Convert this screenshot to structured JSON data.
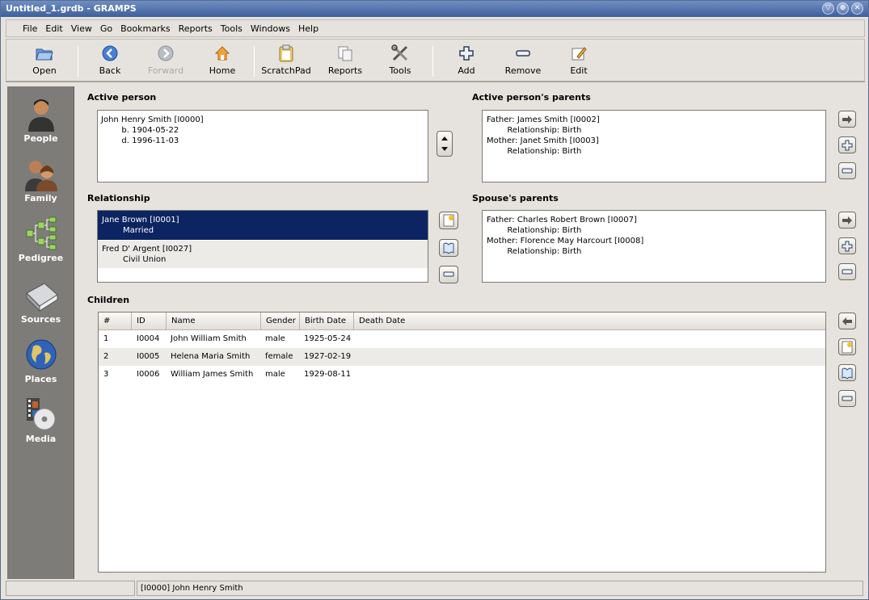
{
  "window": {
    "title": "Untitled_1.grdb - GRAMPS",
    "controls": [
      "▽",
      "⊕",
      "✕"
    ]
  },
  "menu": [
    "File",
    "Edit",
    "View",
    "Go",
    "Bookmarks",
    "Reports",
    "Tools",
    "Windows",
    "Help"
  ],
  "toolbar": {
    "open": "Open",
    "back": "Back",
    "forward": "Forward",
    "home": "Home",
    "scratchpad": "ScratchPad",
    "reports": "Reports",
    "tools": "Tools",
    "add": "Add",
    "remove": "Remove",
    "edit": "Edit"
  },
  "sidebar": {
    "people": "People",
    "family": "Family",
    "pedigree": "Pedigree",
    "sources": "Sources",
    "places": "Places",
    "media": "Media"
  },
  "active_person": {
    "label": "Active person",
    "lines": [
      "John Henry Smith [I0000]",
      "        b. 1904-05-22",
      "        d. 1996-11-03"
    ]
  },
  "active_parents": {
    "label": "Active person's parents",
    "lines": [
      "Father: James Smith [I0002]",
      "        Relationship: Birth",
      "Mother: Janet Smith [I0003]",
      "        Relationship: Birth"
    ]
  },
  "relationship": {
    "label": "Relationship",
    "items": [
      {
        "name": "Jane Brown [I0001]",
        "status": "Married"
      },
      {
        "name": "Fred D' Argent [I0027]",
        "status": "Civil Union"
      }
    ]
  },
  "spouse_parents": {
    "label": "Spouse's parents",
    "lines": [
      "Father: Charles Robert Brown [I0007]",
      "        Relationship: Birth",
      "Mother: Florence May Harcourt [I0008]",
      "        Relationship: Birth"
    ]
  },
  "children": {
    "label": "Children",
    "columns": [
      "#",
      "ID",
      "Name",
      "Gender",
      "Birth Date",
      "Death Date"
    ],
    "rows": [
      [
        "1",
        "I0004",
        "John William Smith",
        "male",
        "1925-05-24",
        ""
      ],
      [
        "2",
        "I0005",
        "Helena Maria Smith",
        "female",
        "1927-02-19",
        ""
      ],
      [
        "3",
        "I0006",
        "William James Smith",
        "male",
        "1929-08-11",
        ""
      ]
    ]
  },
  "status": {
    "left": "",
    "text": "[I0000] John Henry Smith"
  },
  "colors": {
    "selection": "#0c2461",
    "sidebar": "#7e7c78",
    "titlebar": "#4a6aa8"
  }
}
